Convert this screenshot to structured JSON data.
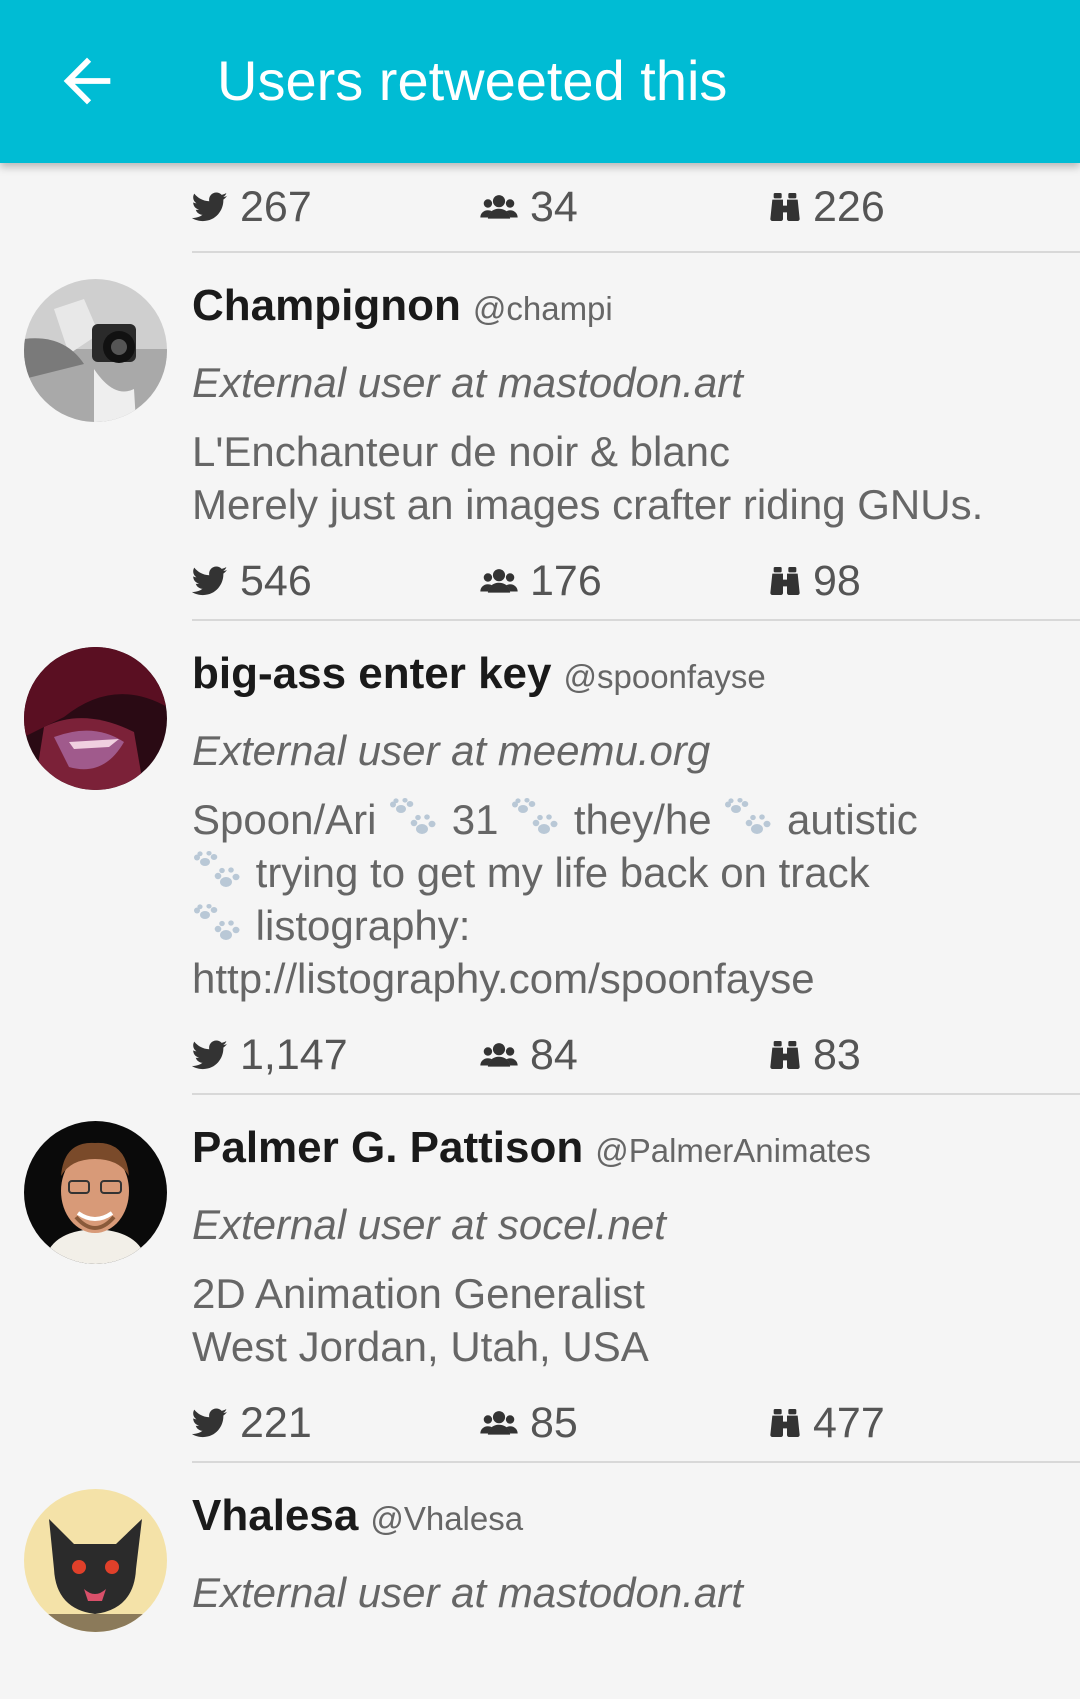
{
  "app_bar": {
    "title": "Users retweeted this",
    "back_icon": "arrow-back-icon",
    "color": "#00bcd4"
  },
  "top_stats": {
    "tweets": "267",
    "followers": "34",
    "following": "226"
  },
  "users": [
    {
      "name": "Champignon",
      "handle": "@champi",
      "origin": "External user at mastodon.art",
      "bio": "L'Enchanteur de noir & blanc\nMerely just an images crafter riding GNUs.",
      "tweets": "546",
      "followers": "176",
      "following": "98"
    },
    {
      "name": "big-ass enter key",
      "handle": "@spoonfayse",
      "origin": "External user at meemu.org",
      "bio_parts": [
        "Spoon/Ari",
        "31",
        "they/he",
        "autistic",
        "trying to get my life back on track",
        "listography: http://listography.com/spoonfayse"
      ],
      "tweets": "1,147",
      "followers": "84",
      "following": "83"
    },
    {
      "name": "Palmer G. Pattison",
      "handle": "@PalmerAnimates",
      "origin": "External user at socel.net",
      "bio": "2D Animation Generalist\nWest Jordan, Utah, USA",
      "tweets": "221",
      "followers": "85",
      "following": "477"
    },
    {
      "name": "Vhalesa",
      "handle": "@Vhalesa",
      "origin": "External user at mastodon.art"
    }
  ],
  "icons": {
    "tweets": "twitter-bird-icon",
    "followers": "followers-group-icon",
    "following": "binoculars-icon",
    "bio_separator": "paw-prints-icon"
  }
}
